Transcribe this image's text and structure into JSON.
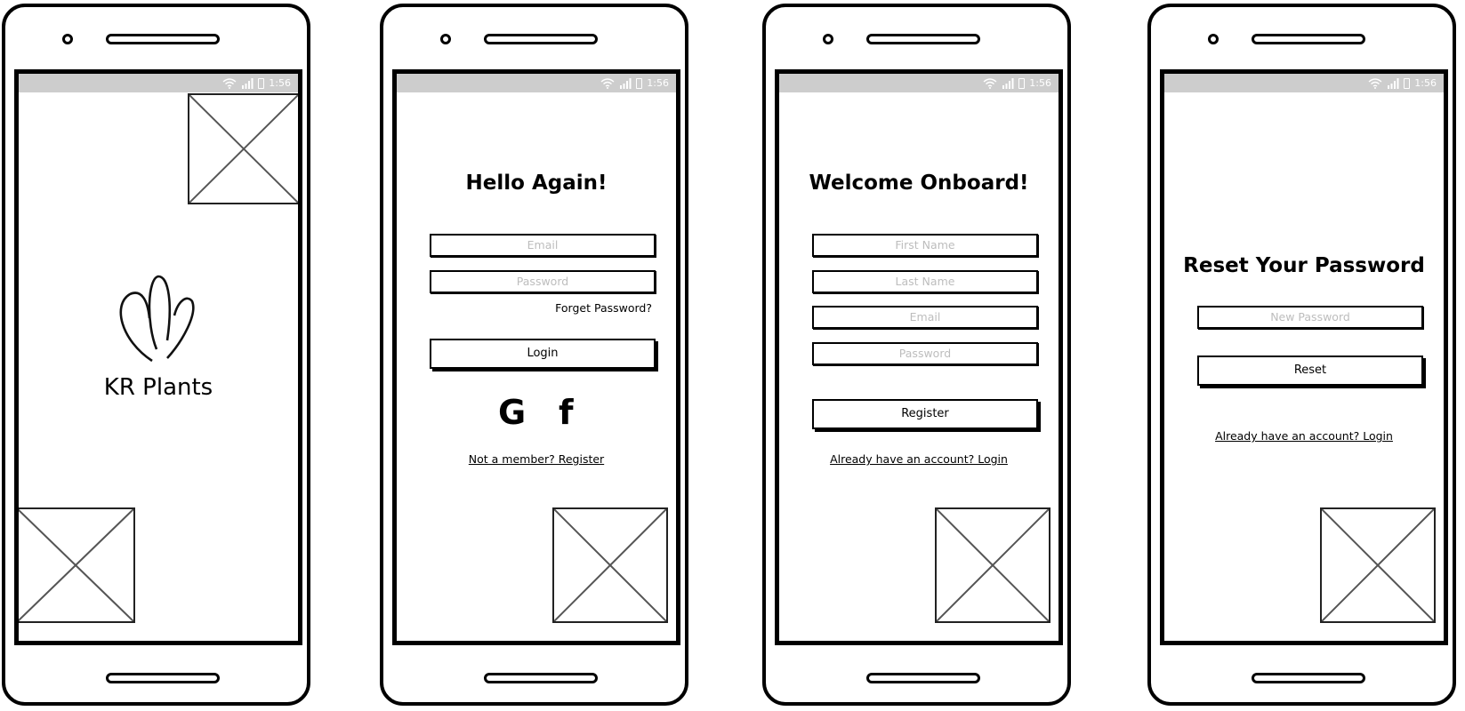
{
  "status_bar": {
    "time": "1:56",
    "wifi_icon": "wifi-icon",
    "signal_icon": "signal-icon",
    "battery_icon": "battery-icon"
  },
  "splash": {
    "brand": "KR Plants",
    "logo_icon": "plant-logo-icon"
  },
  "login": {
    "title": "Hello Again!",
    "email_placeholder": "Email",
    "password_placeholder": "Password",
    "forget_password": "Forget Password?",
    "login_button": "Login",
    "google_glyph": "G",
    "facebook_glyph": "f",
    "register_link": "Not a member? Register"
  },
  "register": {
    "title": "Welcome Onboard!",
    "first_name_placeholder": "First Name",
    "last_name_placeholder": "Last Name",
    "email_placeholder": "Email",
    "password_placeholder": "Password",
    "register_button": "Register",
    "login_link": "Already have an account? Login"
  },
  "reset": {
    "title": "Reset Your Password",
    "new_password_placeholder": "New Password",
    "reset_button": "Reset",
    "login_link": "Already have an account? Login"
  }
}
